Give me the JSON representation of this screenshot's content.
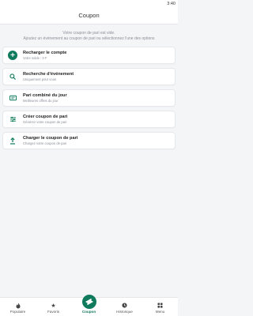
{
  "status_bar": {
    "time": "3:40"
  },
  "header": {
    "title": "Coupon"
  },
  "empty_state": {
    "line1": "Votre coupon de pari est vide.",
    "line2": "Ajoutez un événement au coupon de pari ou sélectionnez l'une des options"
  },
  "options": [
    {
      "title": "Recharger le compte",
      "subtitle": "Votre solde : 0 F",
      "icon": "plus-icon"
    },
    {
      "title": "Recherche d'événement",
      "subtitle": "Uniquement pour vous",
      "icon": "search-icon"
    },
    {
      "title": "Pari combiné du jour",
      "subtitle": "Meilleures offres du jour",
      "icon": "ticket-icon"
    },
    {
      "title": "Créer coupon de pari",
      "subtitle": "Générez votre coupon de pari",
      "icon": "sliders-icon"
    },
    {
      "title": "Charger le coupon de pari",
      "subtitle": "Chargez votre coupon de pari",
      "icon": "upload-icon"
    }
  ],
  "bottom_nav": [
    {
      "label": "Populaire",
      "icon": "flame-icon"
    },
    {
      "label": "Favoris",
      "icon": "star-icon"
    },
    {
      "label": "Coupon",
      "icon": "ticket-icon",
      "active": true
    },
    {
      "label": "Historique",
      "icon": "clock-icon"
    },
    {
      "label": "Menu",
      "icon": "grid-icon"
    }
  ],
  "colors": {
    "accent": "#0f7a5c"
  }
}
